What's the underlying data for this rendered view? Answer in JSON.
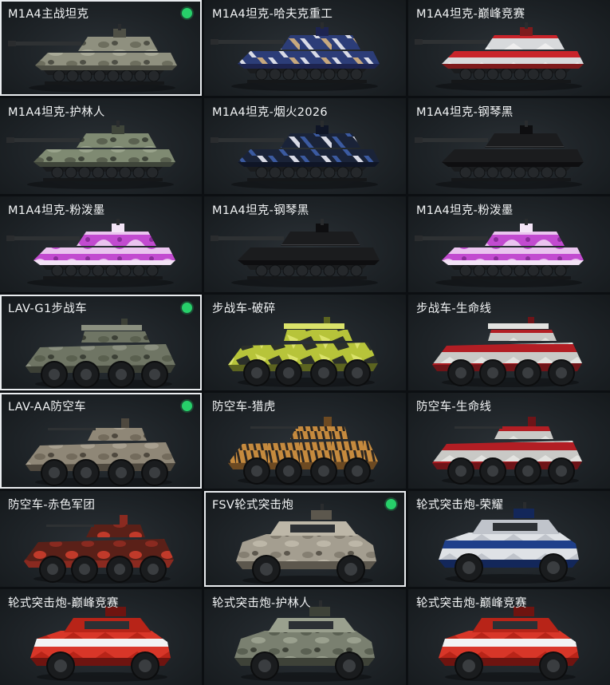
{
  "cards": [
    {
      "label": "M1A4主战坦克",
      "selected": true,
      "kind": "tank",
      "skin": "camo_tan",
      "colors": [
        "#8f907f",
        "#6d6e5e",
        "#a9aa98",
        "#4f5046"
      ]
    },
    {
      "label": "M1A4坦克-哈夫克重工",
      "selected": false,
      "kind": "tank",
      "skin": "blue_abstract",
      "colors": [
        "#2c3d78",
        "#d9dbe6",
        "#c7a87e",
        "#1d2450"
      ]
    },
    {
      "label": "M1A4坦克-巅峰竞赛",
      "selected": false,
      "kind": "tank",
      "skin": "red_white",
      "colors": [
        "#d8dadc",
        "#c9242a",
        "#eeeeee",
        "#7e1a1c"
      ]
    },
    {
      "label": "M1A4坦克-护林人",
      "selected": false,
      "kind": "tank",
      "skin": "camo_green",
      "colors": [
        "#7f8a72",
        "#5a6150",
        "#9aa48c",
        "#3f453a"
      ]
    },
    {
      "label": "M1A4坦克-烟火2026",
      "selected": false,
      "kind": "tank",
      "skin": "fireworks",
      "colors": [
        "#1a2338",
        "#3b5aa0",
        "#d9dbe6",
        "#0f1526"
      ]
    },
    {
      "label": "M1A4坦克-钢琴黑",
      "selected": false,
      "kind": "tank",
      "skin": "black",
      "colors": [
        "#1b1c1e",
        "#2b2c2f",
        "#3c3d40",
        "#0e0e10"
      ]
    },
    {
      "label": "M1A4坦克-粉泼墨",
      "selected": false,
      "kind": "tank",
      "skin": "pink",
      "colors": [
        "#c24bd0",
        "#eac4ef",
        "#8a2c9a",
        "#f3e4f6"
      ]
    },
    {
      "label": "M1A4坦克-钢琴黑",
      "selected": false,
      "kind": "tank",
      "skin": "black",
      "colors": [
        "#1b1c1e",
        "#2b2c2f",
        "#3c3d40",
        "#0e0e10"
      ]
    },
    {
      "label": "M1A4坦克-粉泼墨",
      "selected": false,
      "kind": "tank",
      "skin": "pink",
      "colors": [
        "#c24bd0",
        "#eac4ef",
        "#8a2c9a",
        "#f3e4f6"
      ]
    },
    {
      "label": "LAV-G1步战车",
      "selected": true,
      "kind": "ifv",
      "skin": "olive",
      "colors": [
        "#6f7564",
        "#5a604f",
        "#8b9080",
        "#3c4036"
      ]
    },
    {
      "label": "步战车-破碎",
      "selected": false,
      "kind": "ifv",
      "skin": "yellow",
      "colors": [
        "#b7c43a",
        "#2b2f2a",
        "#dbe36a",
        "#5c6420"
      ]
    },
    {
      "label": "步战车-生命线",
      "selected": false,
      "kind": "ifv",
      "skin": "lifeline",
      "colors": [
        "#c9c9c6",
        "#b21e24",
        "#e3e3e0",
        "#6e1418"
      ]
    },
    {
      "label": "LAV-AA防空车",
      "selected": true,
      "kind": "aa",
      "skin": "sand",
      "colors": [
        "#8f8777",
        "#736b5c",
        "#a8a090",
        "#4e483e"
      ]
    },
    {
      "label": "防空车-猎虎",
      "selected": false,
      "kind": "aa",
      "skin": "tiger",
      "colors": [
        "#c58a3e",
        "#2a2622",
        "#e0aa5c",
        "#6d4a22"
      ]
    },
    {
      "label": "防空车-生命线",
      "selected": false,
      "kind": "aa",
      "skin": "lifeline",
      "colors": [
        "#c9c9c6",
        "#b21e24",
        "#e3e3e0",
        "#6e1418"
      ]
    },
    {
      "label": "防空车-赤色军团",
      "selected": false,
      "kind": "aa",
      "skin": "red_black",
      "colors": [
        "#5a2018",
        "#c13a2a",
        "#2a1210",
        "#8a2a20"
      ]
    },
    {
      "label": "FSV轮式突击炮",
      "selected": true,
      "kind": "fsv",
      "skin": "sand",
      "colors": [
        "#a49e90",
        "#857f72",
        "#bdb7a8",
        "#5c574d"
      ]
    },
    {
      "label": "轮式突击炮-荣耀",
      "selected": false,
      "kind": "fsv",
      "skin": "blue_white",
      "colors": [
        "#dfe2e6",
        "#1f3f8a",
        "#c0c4cb",
        "#13275a"
      ]
    },
    {
      "label": "轮式突击炮-巅峰竞赛",
      "selected": false,
      "kind": "fsv",
      "skin": "red_white",
      "colors": [
        "#d83628",
        "#f2f2f2",
        "#b82418",
        "#6e1410"
      ]
    },
    {
      "label": "轮式突击炮-护林人",
      "selected": false,
      "kind": "fsv",
      "skin": "camo_green",
      "colors": [
        "#7a8070",
        "#5a6052",
        "#9aa08e",
        "#3e4238"
      ]
    },
    {
      "label": "轮式突击炮-巅峰竞赛",
      "selected": false,
      "kind": "fsv",
      "skin": "red_white",
      "colors": [
        "#d83628",
        "#f2f2f2",
        "#b82418",
        "#6e1410"
      ]
    }
  ]
}
